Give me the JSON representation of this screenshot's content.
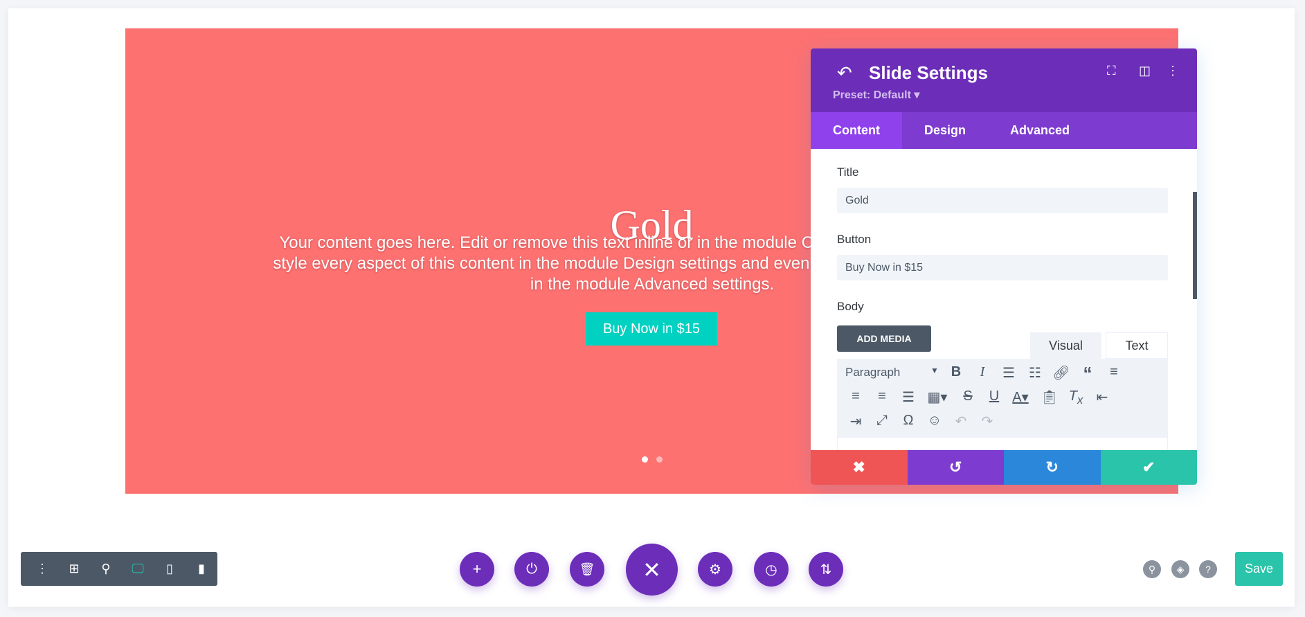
{
  "slide": {
    "title": "Gold",
    "body": "Your content goes here. Edit or remove this text inline or in the module Content settings. You can also style every aspect of this content in the module Design settings and even apply custom CSS to this text in the module Advanced settings.",
    "button": "Buy Now in $15",
    "background": "#fe7171",
    "button_color": "#00d1c1",
    "active_dot": 1,
    "dot_count": 2
  },
  "panel": {
    "title": "Slide Settings",
    "preset": "Preset: Default ▾",
    "tabs": [
      "Content",
      "Design",
      "Advanced"
    ],
    "fields": {
      "title_label": "Title",
      "title_value": "Gold",
      "button_label": "Button",
      "button_value": "Buy Now in $15",
      "body_label": "Body"
    },
    "add_media": "ADD MEDIA",
    "editor_tabs": [
      "Visual",
      "Text"
    ],
    "format": "Paragraph",
    "footer_colors": [
      "#ef5555",
      "#7e3bd0",
      "#2b87da",
      "#29c4a9"
    ]
  },
  "toolbar": {
    "save": "Save"
  }
}
